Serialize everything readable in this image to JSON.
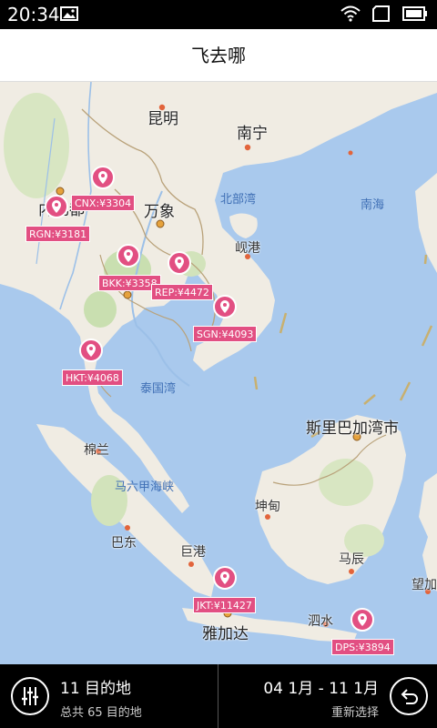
{
  "status_bar": {
    "time": "20:34"
  },
  "header": {
    "title": "飞去哪"
  },
  "map": {
    "places": {
      "kunming": "昆明",
      "nanning": "南宁",
      "beibu_gulf": "北部湾",
      "south_china_sea": "南海",
      "naypyidaw": "内比都",
      "vientiane": "万象",
      "da_nang": "岘港",
      "gulf_of_thailand": "泰国湾",
      "kota_kinabalu": "斯里巴加湾市",
      "medan": "棉兰",
      "strait_of_malacca": "马六甲海峡",
      "padang": "巴东",
      "palembang": "巨港",
      "jakarta": "雅加达",
      "pontianak": "坤甸",
      "banjarmasin": "马辰",
      "surabaya": "泗水",
      "wangjia": "望加"
    },
    "destinations": [
      {
        "code": "CNX",
        "label": "CNX:¥3304"
      },
      {
        "code": "RGN",
        "label": "RGN:¥3181"
      },
      {
        "code": "BKK",
        "label": "BKK:¥3358"
      },
      {
        "code": "REP",
        "label": "REP:¥4472"
      },
      {
        "code": "SGN",
        "label": "SGN:¥4093"
      },
      {
        "code": "HKT",
        "label": "HKT:¥4068"
      },
      {
        "code": "JKT",
        "label": "JKT:¥11427"
      },
      {
        "code": "DPS",
        "label": "DPS:¥3894"
      }
    ]
  },
  "footer": {
    "dest_count": "11 目的地",
    "dest_total": "总共 65 目的地",
    "date_range": "04 1月 - 11 1月",
    "reselect": "重新选择"
  },
  "colors": {
    "land": "#f0ece3",
    "water": "#a9c9ed",
    "forest": "#c9dfb0",
    "marker": "#e24f82"
  }
}
